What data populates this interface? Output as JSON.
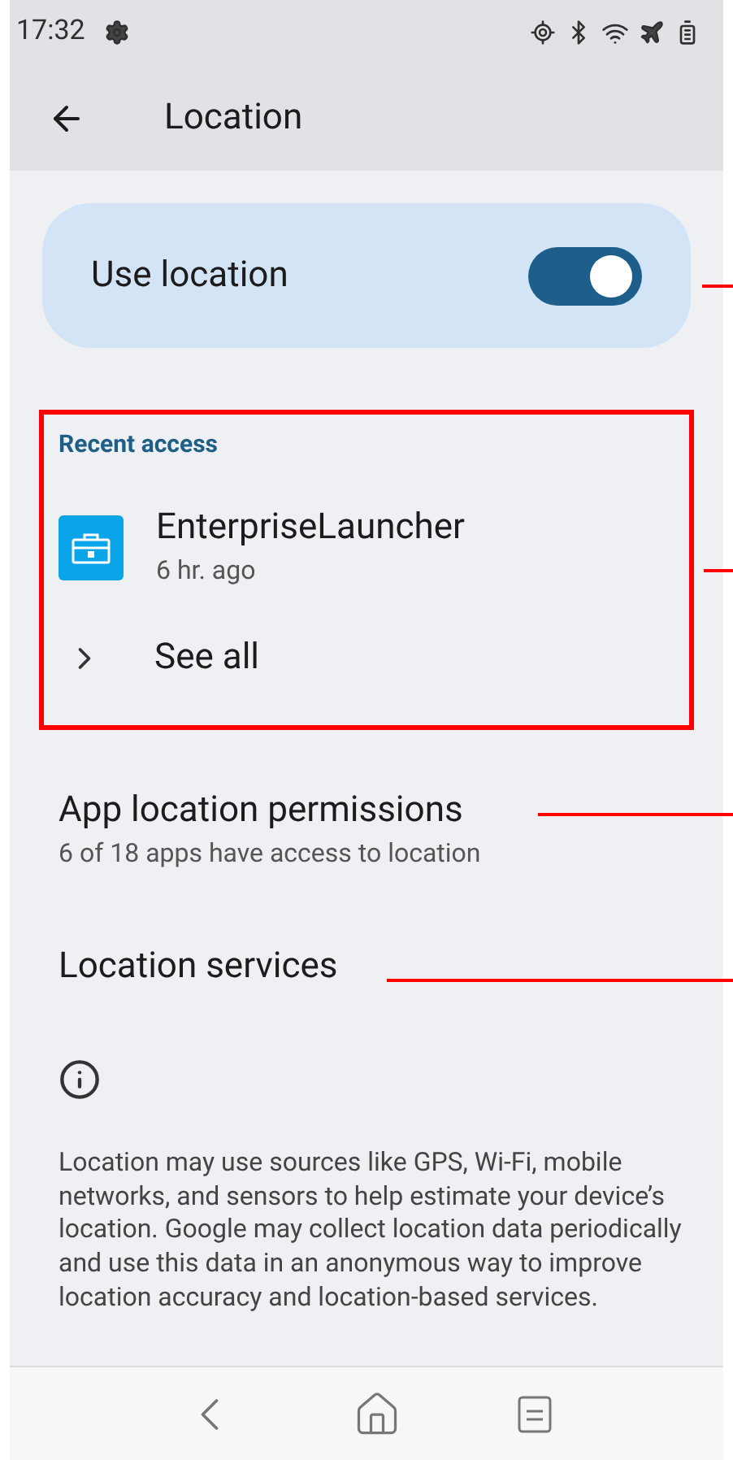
{
  "status_bar": {
    "time": "17:32"
  },
  "toolbar": {
    "title": "Location"
  },
  "use_location": {
    "label": "Use location",
    "on": true
  },
  "recent_access": {
    "heading": "Recent access",
    "apps": [
      {
        "name": "EnterpriseLauncher",
        "time": "6 hr. ago"
      }
    ],
    "see_all": "See all"
  },
  "settings": [
    {
      "title": "App location permissions",
      "subtitle": "6 of 18 apps have access to location"
    },
    {
      "title": "Location services"
    }
  ],
  "info": {
    "text": "Location may use sources like GPS, Wi-Fi, mobile networks, and sensors to help estimate your device’s location. Google may collect location data periodically and use this data in an anonymous way to improve location accuracy and location-based services."
  }
}
